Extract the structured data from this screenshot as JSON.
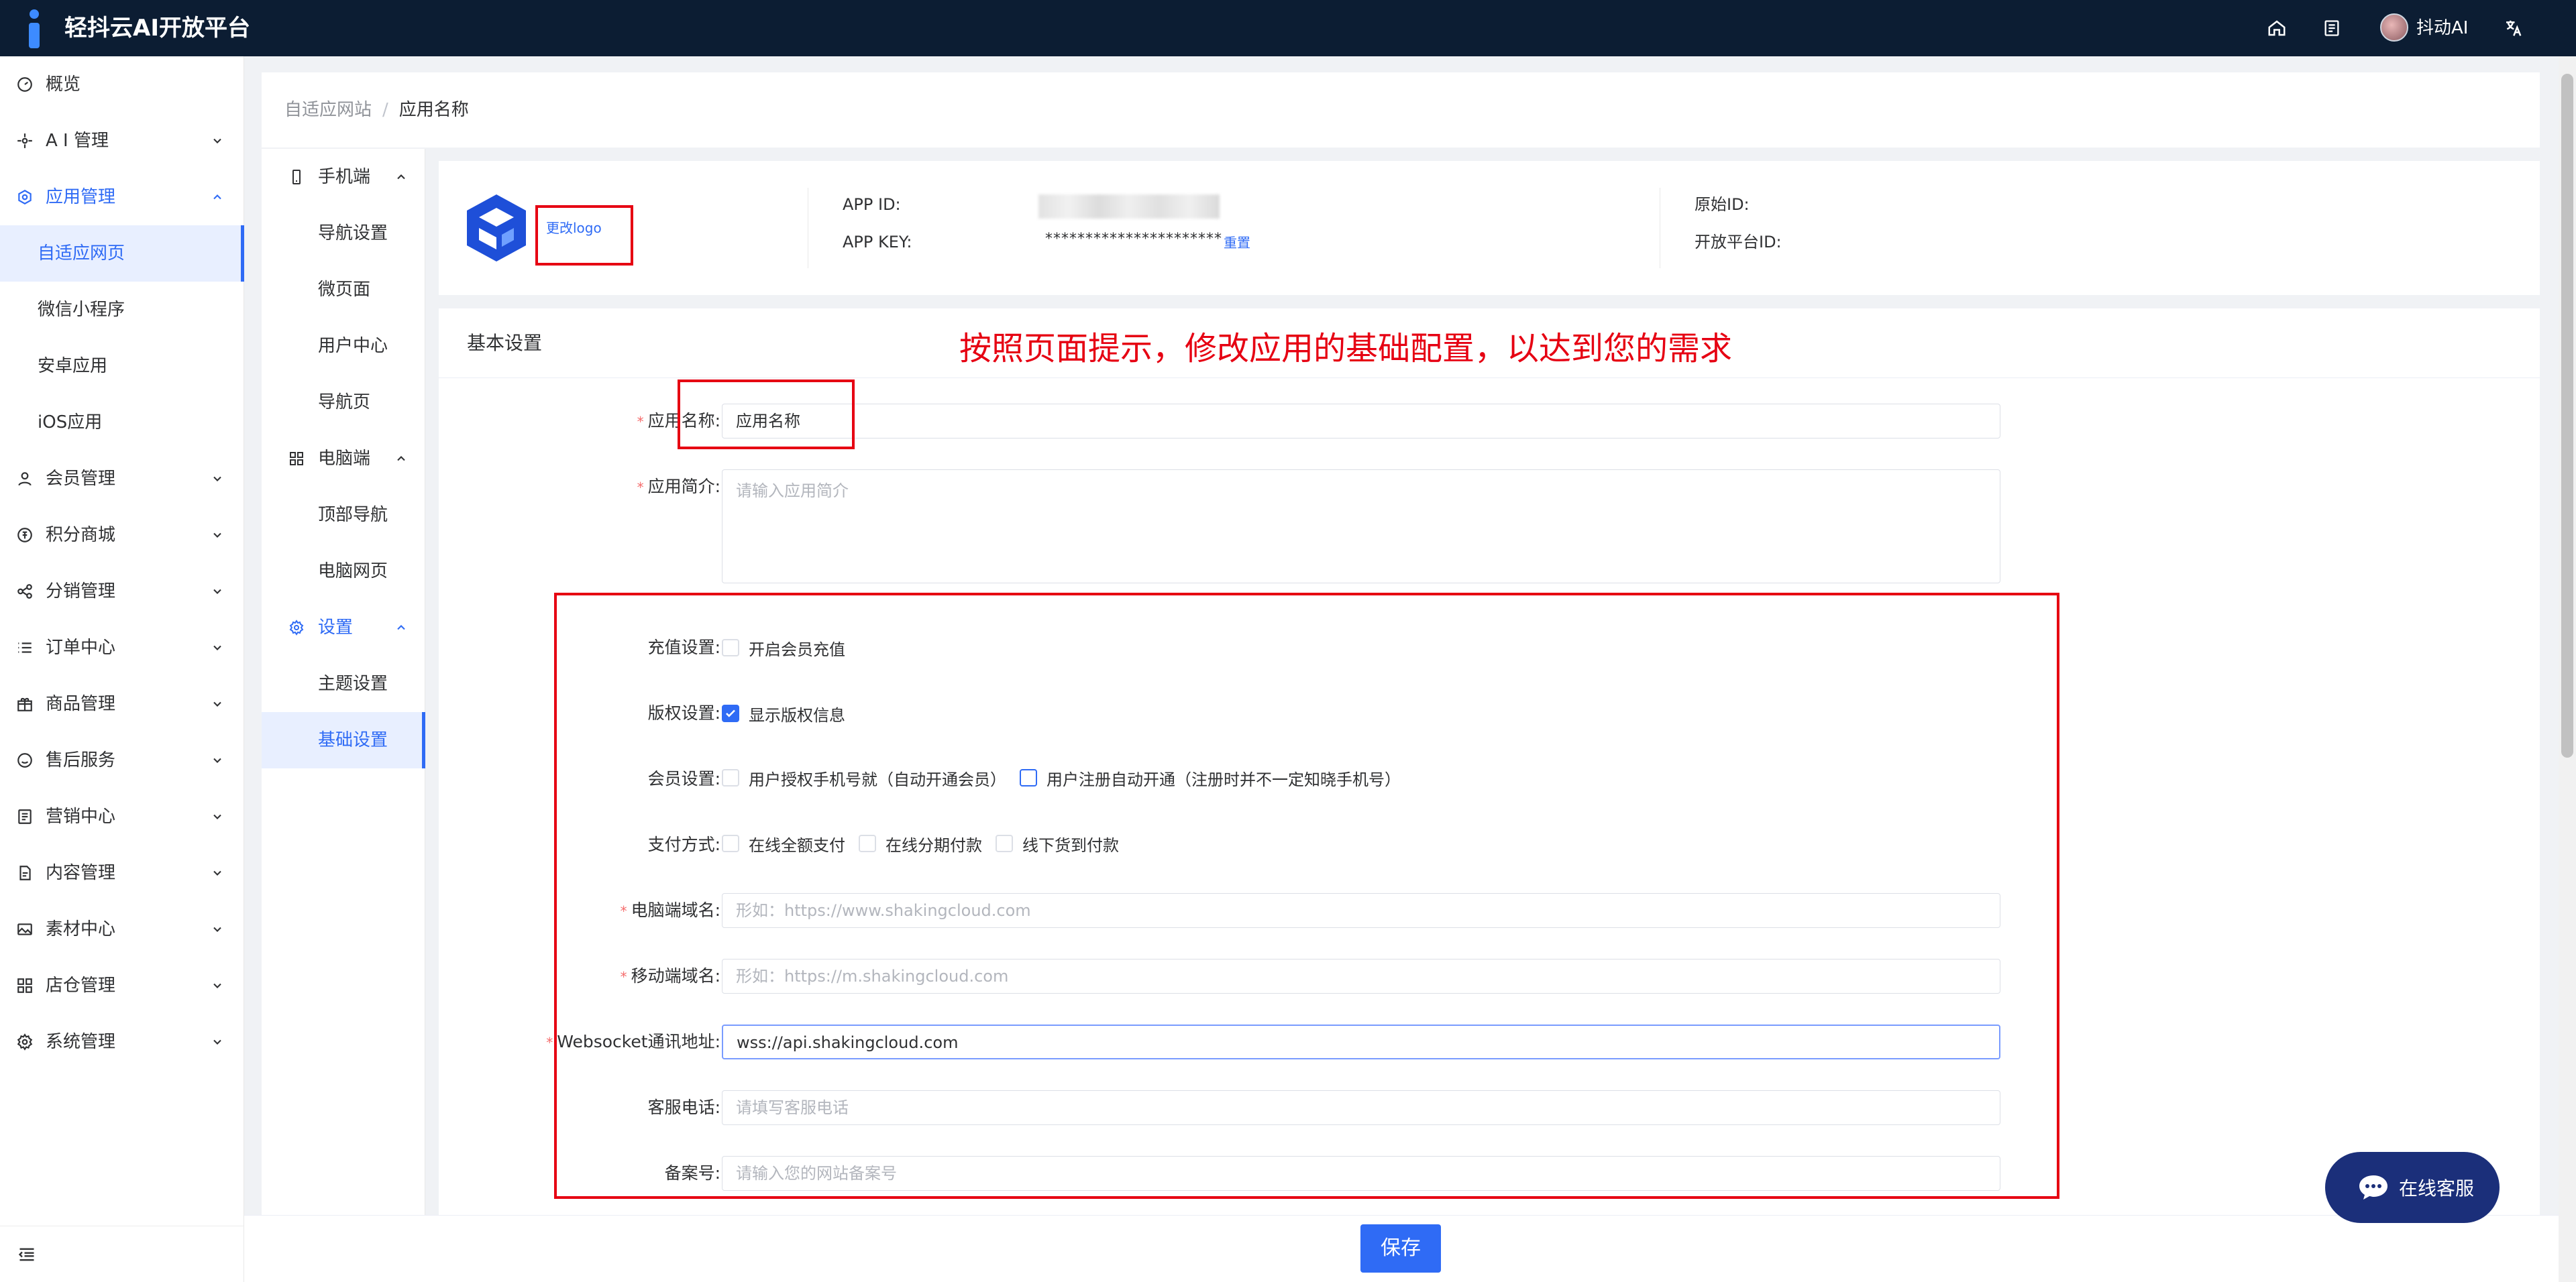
{
  "app": {
    "title": "轻抖云AI开放平台",
    "brand_color": "#2f6bf5",
    "topbar_color": "#0c1d33"
  },
  "topbar": {
    "home_icon": "home-icon",
    "doc_icon": "document-icon",
    "user_name": "抖动AI",
    "lang_icon": "translate-icon"
  },
  "sidebar": {
    "items": [
      {
        "label": "概览",
        "icon": "dashboard-icon"
      },
      {
        "label": "A I 管理",
        "icon": "ai-icon"
      },
      {
        "label": "应用管理",
        "icon": "app-icon"
      },
      {
        "label": "会员管理",
        "icon": "user-icon"
      },
      {
        "label": "积分商城",
        "icon": "points-icon"
      },
      {
        "label": "分销管理",
        "icon": "share-icon"
      },
      {
        "label": "订单中心",
        "icon": "list-icon"
      },
      {
        "label": "商品管理",
        "icon": "gift-icon"
      },
      {
        "label": "售后服务",
        "icon": "service-icon"
      },
      {
        "label": "营销中心",
        "icon": "marketing-icon"
      },
      {
        "label": "内容管理",
        "icon": "content-icon"
      },
      {
        "label": "素材中心",
        "icon": "image-icon"
      },
      {
        "label": "店仓管理",
        "icon": "store-icon"
      },
      {
        "label": "系统管理",
        "icon": "settings-icon"
      }
    ],
    "sub_items": [
      "自适应网页",
      "微信小程序",
      "安卓应用",
      "iOS应用"
    ]
  },
  "breadcrumb": {
    "parent": "自适应网站",
    "separator": "/",
    "current": "应用名称"
  },
  "secondnav": {
    "group_mobile": "手机端",
    "mobile_items": [
      "导航设置",
      "微页面",
      "用户中心",
      "导航页"
    ],
    "group_pc": "电脑端",
    "pc_items": [
      "顶部导航",
      "电脑网页"
    ],
    "group_settings": "设置",
    "settings_items": [
      "主题设置",
      "基础设置"
    ]
  },
  "app_info": {
    "change_logo": "更改logo",
    "app_id_label": "APP ID:",
    "app_key_label": "APP KEY:",
    "app_key_value": "**********************",
    "reset": "重置",
    "original_id_label": "原始ID:",
    "platform_id_label": "开放平台ID:"
  },
  "form": {
    "title": "基本设置",
    "annotation": "按照页面提示，修改应用的基础配置，以达到您的需求",
    "name_label": "应用名称:",
    "name_value": "应用名称",
    "intro_label": "应用简介:",
    "intro_placeholder": "请输入应用简介",
    "recharge_label": "充值设置:",
    "recharge_opt": "开启会员充值",
    "copyright_label": "版权设置:",
    "copyright_opt": "显示版权信息",
    "member_label": "会员设置:",
    "member_opt1": "用户授权手机号就（自动开通会员）",
    "member_opt2": "用户注册自动开通（注册时并不一定知晓手机号）",
    "pay_label": "支付方式:",
    "pay_opt1": "在线全额支付",
    "pay_opt2": "在线分期付款",
    "pay_opt3": "线下货到付款",
    "pc_domain_label": "电脑端域名:",
    "pc_domain_placeholder": "形如：https://www.shakingcloud.com",
    "m_domain_label": "移动端域名:",
    "m_domain_placeholder": "形如：https://m.shakingcloud.com",
    "ws_label": "Websocket通讯地址:",
    "ws_value": "wss://api.shakingcloud.com",
    "phone_label": "客服电话:",
    "phone_placeholder": "请填写客服电话",
    "icp_label": "备案号:",
    "icp_placeholder": "请输入您的网站备案号",
    "required_mark": "*"
  },
  "footer": {
    "save": "保存"
  },
  "chat": {
    "label": "在线客服"
  }
}
